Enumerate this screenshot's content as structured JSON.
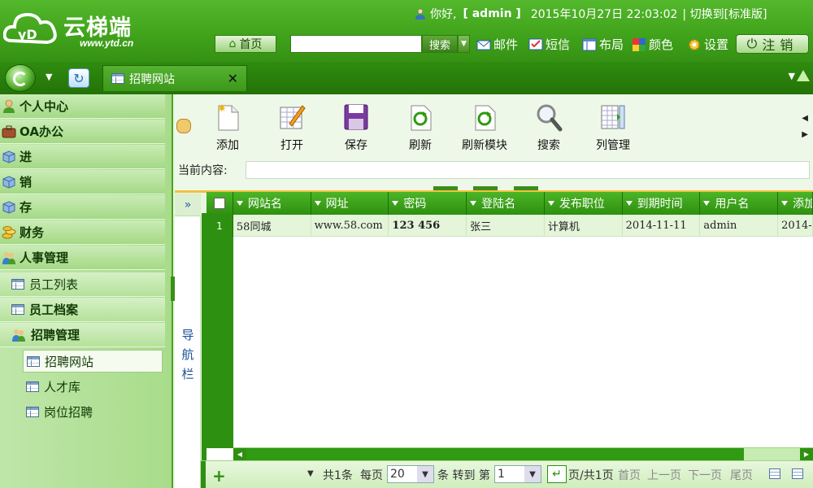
{
  "header": {
    "logo_text": "云梯端",
    "logo_url": "www.ytd.cn",
    "greeting": "你好,",
    "username": "[ admin ]",
    "datetime": "2015年10月27日  22:03:02",
    "switch_text": "| 切换到[标准版]",
    "home_label": "首页",
    "search_placeholder": "",
    "search_button": "搜索",
    "links": {
      "mail": "邮件",
      "sms": "短信",
      "layout": "布局",
      "color": "颜色",
      "settings": "设置"
    },
    "logout": "注销"
  },
  "tabbar": {
    "active_tab": "招聘网站",
    "close": "✕"
  },
  "sidebar": {
    "items": [
      {
        "label": "个人中心",
        "icon": "person-icon"
      },
      {
        "label": "OA办公",
        "icon": "briefcase-icon"
      },
      {
        "label": "进",
        "icon": "box-icon"
      },
      {
        "label": "销",
        "icon": "box-icon"
      },
      {
        "label": "存",
        "icon": "box-icon"
      },
      {
        "label": "财务",
        "icon": "coins-icon"
      },
      {
        "label": "人事管理",
        "icon": "people-icon"
      }
    ],
    "hr_sub": [
      {
        "label": "员工列表"
      },
      {
        "label": "员工档案"
      },
      {
        "label": "招聘管理"
      }
    ],
    "recruit_leaves": [
      {
        "label": "招聘网站"
      },
      {
        "label": "人才库"
      },
      {
        "label": "岗位招聘"
      }
    ]
  },
  "toolbar": {
    "buttons": [
      "添加",
      "打开",
      "保存",
      "刷新",
      "刷新模块",
      "搜索",
      "列管理"
    ],
    "current_label": "当前内容:",
    "current_value": ""
  },
  "nav": {
    "expand": "»",
    "label": "导航栏"
  },
  "grid": {
    "columns": [
      "网站名",
      "网址",
      "密码",
      "登陆名",
      "发布职位",
      "到期时间",
      "用户名",
      "添加"
    ],
    "rows": [
      {
        "num": "1",
        "cells": [
          "58同城",
          "www.58.com",
          "123  456",
          "张三",
          "计算机",
          "2014-11-11",
          "admin",
          "2014-1"
        ]
      }
    ]
  },
  "pager": {
    "total": "共1条",
    "per_page_label": "每页",
    "per_page": "20",
    "unit_goto": "条 转到 第",
    "page": "1",
    "page_of": "页/共1页",
    "first": "首页",
    "prev": "上一页",
    "next": "下一页",
    "last": "尾页"
  },
  "colors": {
    "header_green": "#3fa21a",
    "grid_header": "#2e9010",
    "row_bg": "#e4f5da",
    "accent_yellow": "#f0c33c"
  }
}
